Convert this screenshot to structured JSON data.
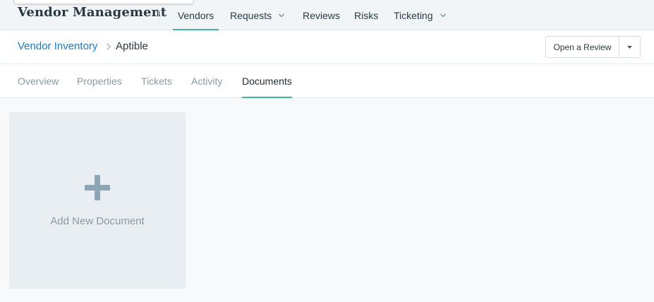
{
  "header": {
    "brand": "Vendor Management",
    "nav": [
      {
        "label": "Vendors",
        "active": true
      },
      {
        "label": "Requests",
        "has_dropdown": true
      },
      {
        "label": "Reviews"
      },
      {
        "label": "Risks"
      },
      {
        "label": "Ticketing",
        "has_dropdown": true
      }
    ]
  },
  "breadcrumb": {
    "parent": "Vendor Inventory",
    "current": "Aptible"
  },
  "actions": {
    "open_review_label": "Open a Review"
  },
  "tabs": [
    {
      "label": "Overview"
    },
    {
      "label": "Properties"
    },
    {
      "label": "Tickets"
    },
    {
      "label": "Activity"
    },
    {
      "label": "Documents",
      "active": true
    }
  ],
  "documents": {
    "add_label": "Add New Document"
  },
  "colors": {
    "accent": "#3fb59a",
    "link": "#1a7ad1",
    "muted_text": "#8a9aa3",
    "card_bg": "#e9eef2",
    "plus_icon": "#8ea6b3"
  },
  "icons": {
    "nav_dropdown": "chevron-down-icon",
    "breadcrumb_separator": "chevron-right-icon",
    "button_caret": "caret-down-icon",
    "add": "plus-icon"
  }
}
